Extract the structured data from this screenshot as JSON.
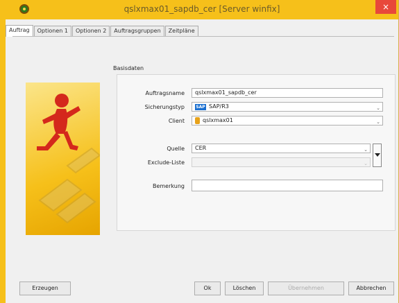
{
  "window": {
    "title": "qslxmax01_sapdb_cer [Server winfix]",
    "close_glyph": "×"
  },
  "tabs": [
    {
      "label": "Auftrag",
      "active": true
    },
    {
      "label": "Optionen 1",
      "active": false
    },
    {
      "label": "Optionen 2",
      "active": false
    },
    {
      "label": "Auftragsgruppen",
      "active": false
    },
    {
      "label": "Zeitpläne",
      "active": false
    }
  ],
  "basisdaten": {
    "group_title": "Basisdaten",
    "auftragsname": {
      "label": "Auftragsname",
      "value": "qslxmax01_sapdb_cer"
    },
    "sicherungstyp": {
      "label": "Sicherungstyp",
      "logo": "SAP",
      "value": "SAP/R3"
    },
    "client": {
      "label": "Client",
      "value": "qslxmax01"
    },
    "quelle": {
      "label": "Quelle",
      "value": "CER"
    },
    "exclude_liste": {
      "label": "Exclude-Liste",
      "value": ""
    },
    "bemerkung": {
      "label": "Bemerkung",
      "value": ""
    }
  },
  "buttons": {
    "erzeugen": "Erzeugen",
    "ok": "Ok",
    "loeschen": "Löschen",
    "uebernehmen": "Übernehmen",
    "abbrechen": "Abbrechen"
  },
  "colors": {
    "accent": "#f6c01a",
    "close": "#e8483a",
    "figure_red": "#d4281c"
  }
}
